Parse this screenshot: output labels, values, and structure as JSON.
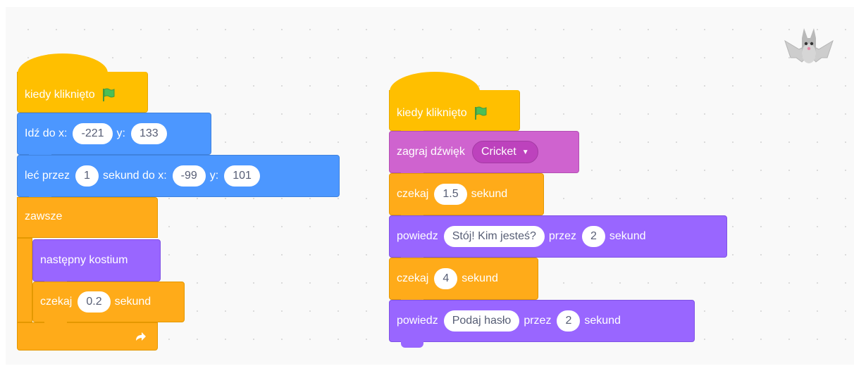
{
  "script1": {
    "hat": {
      "label": "kiedy kliknięto",
      "icon": "green-flag-icon"
    },
    "goto": {
      "label": "Idź do x:",
      "x": "-221",
      "y_label": "y:",
      "y": "133"
    },
    "glide": {
      "label": "leć przez",
      "secs": "1",
      "mid": "sekund do x:",
      "x": "-99",
      "y_label": "y:",
      "y": "101"
    },
    "forever": {
      "label": "zawsze",
      "loop_icon": "loop-arrow-icon"
    },
    "next_costume": {
      "label": "następny kostium"
    },
    "wait": {
      "label": "czekaj",
      "value": "0.2",
      "unit": "sekund"
    }
  },
  "script2": {
    "hat": {
      "label": "kiedy kliknięto",
      "icon": "green-flag-icon"
    },
    "play_sound": {
      "label": "zagraj dźwięk",
      "sound": "Cricket"
    },
    "wait1": {
      "label": "czekaj",
      "value": "1.5",
      "unit": "sekund"
    },
    "say1": {
      "label": "powiedz",
      "text": "Stój! Kim jesteś?",
      "mid": "przez",
      "secs": "2",
      "unit": "sekund"
    },
    "wait2": {
      "label": "czekaj",
      "value": "4",
      "unit": "sekund"
    },
    "say2": {
      "label": "powiedz",
      "text": "Podaj hasło",
      "mid": "przez",
      "secs": "2",
      "unit": "sekund"
    }
  },
  "sprite": {
    "icon": "bat-sprite-icon"
  },
  "colors": {
    "events": "#ffbf00",
    "motion": "#4c97ff",
    "looks": "#9966ff",
    "sound": "#cf63cf",
    "control": "#ffab19"
  }
}
